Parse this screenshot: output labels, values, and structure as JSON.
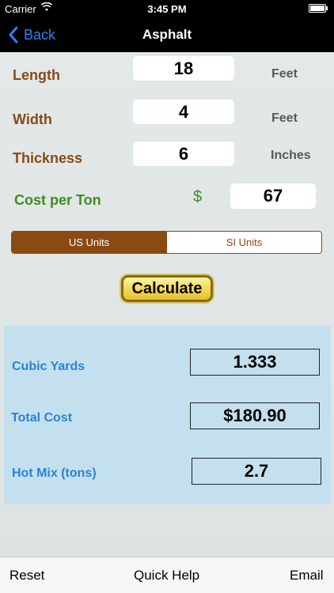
{
  "status_bar": {
    "carrier": "Carrier",
    "time": "3:45 PM"
  },
  "nav": {
    "back_label": "Back",
    "title": "Asphalt"
  },
  "inputs": {
    "length": {
      "label": "Length",
      "value": "18",
      "unit": "Feet"
    },
    "width": {
      "label": "Width",
      "value": "4",
      "unit": "Feet"
    },
    "thickness": {
      "label": "Thickness",
      "value": "6",
      "unit": "Inches"
    },
    "cost": {
      "label": "Cost per Ton",
      "currency": "$",
      "value": "67"
    }
  },
  "units_toggle": {
    "options": [
      "US Units",
      "SI Units"
    ],
    "selected": "US Units"
  },
  "calculate_label": "Calculate",
  "results": {
    "cubic_yards": {
      "label": "Cubic Yards",
      "value": "1.333"
    },
    "total_cost": {
      "label": "Total Cost",
      "value": "$180.90"
    },
    "hot_mix": {
      "label": "Hot Mix (tons)",
      "value": "2.7"
    }
  },
  "toolbar": {
    "reset": "Reset",
    "quick_help": "Quick Help",
    "email": "Email"
  },
  "colors": {
    "brown": "#8a4a14",
    "green": "#3d8f1f",
    "blue": "#2a83d4",
    "results_bg": "#c4e0ee",
    "ios_blue": "#2a83f0"
  }
}
